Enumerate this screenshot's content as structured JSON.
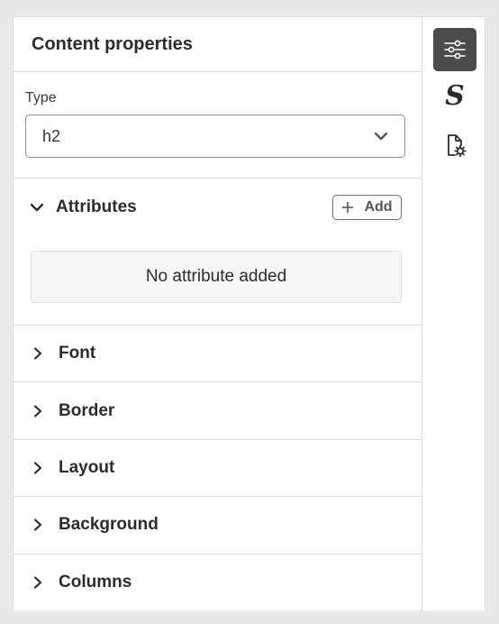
{
  "panel": {
    "title": "Content properties",
    "type_field": {
      "label": "Type",
      "value": "h2"
    },
    "attributes": {
      "title": "Attributes",
      "add_label": "Add",
      "empty_message": "No attribute added"
    },
    "sections": [
      {
        "label": "Font"
      },
      {
        "label": "Border"
      },
      {
        "label": "Layout"
      },
      {
        "label": "Background"
      },
      {
        "label": "Columns"
      }
    ]
  },
  "rail": {
    "items": [
      {
        "icon": "sliders-icon",
        "active": true
      },
      {
        "icon": "styles-icon",
        "glyph": "S",
        "active": false
      },
      {
        "icon": "page-settings-icon",
        "active": false
      }
    ]
  },
  "colors": {
    "active_rail_bg": "#4b4b4b",
    "border": "#dcdcdc",
    "empty_box_bg": "#f6f6f6"
  }
}
